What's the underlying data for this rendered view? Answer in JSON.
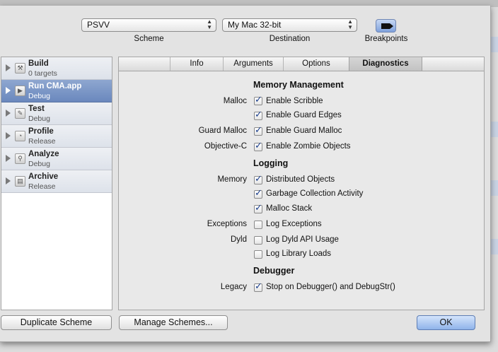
{
  "toolbar": {
    "scheme_value": "PSVV",
    "scheme_label": "Scheme",
    "destination_value": "My Mac 32-bit",
    "destination_label": "Destination",
    "breakpoints_label": "Breakpoints"
  },
  "sidebar": {
    "items": [
      {
        "name": "Build",
        "sub": "0 targets",
        "icon": "hammer-icon"
      },
      {
        "name": "Run CMA.app",
        "sub": "Debug",
        "icon": "play-icon"
      },
      {
        "name": "Test",
        "sub": "Debug",
        "icon": "wrench-icon"
      },
      {
        "name": "Profile",
        "sub": "Release",
        "icon": "gauge-icon"
      },
      {
        "name": "Analyze",
        "sub": "Debug",
        "icon": "magnifier-icon"
      },
      {
        "name": "Archive",
        "sub": "Release",
        "icon": "box-icon"
      }
    ],
    "selected_index": 1
  },
  "tabs": {
    "info": "Info",
    "arguments": "Arguments",
    "options": "Options",
    "diagnostics": "Diagnostics",
    "active": "Diagnostics"
  },
  "diagnostics": {
    "memory": {
      "title": "Memory Management",
      "malloc_label": "Malloc",
      "scribble": {
        "label": "Enable Scribble",
        "checked": true
      },
      "guard_edges": {
        "label": "Enable Guard Edges",
        "checked": true
      },
      "guard_malloc_label": "Guard Malloc",
      "guard_malloc": {
        "label": "Enable Guard Malloc",
        "checked": true
      },
      "objc_label": "Objective-C",
      "zombie": {
        "label": "Enable Zombie Objects",
        "checked": true
      }
    },
    "logging": {
      "title": "Logging",
      "memory_label": "Memory",
      "distributed": {
        "label": "Distributed Objects",
        "checked": true
      },
      "gc": {
        "label": "Garbage Collection Activity",
        "checked": true
      },
      "malloc_stack": {
        "label": "Malloc Stack",
        "checked": true
      },
      "exceptions_label": "Exceptions",
      "log_exceptions": {
        "label": "Log Exceptions",
        "checked": false
      },
      "dyld_label": "Dyld",
      "dyld_api": {
        "label": "Log Dyld API Usage",
        "checked": false
      },
      "library_loads": {
        "label": "Log Library Loads",
        "checked": false
      }
    },
    "debugger": {
      "title": "Debugger",
      "legacy_label": "Legacy",
      "stop_debugger": {
        "label": "Stop on Debugger() and DebugStr()",
        "checked": true
      }
    }
  },
  "buttons": {
    "duplicate": "Duplicate Scheme",
    "manage": "Manage Schemes...",
    "ok": "OK"
  },
  "colors": {
    "selection": "#6f8cbf",
    "ok_button": "#8fb3ea",
    "checkmark": "#1b3e8c"
  }
}
